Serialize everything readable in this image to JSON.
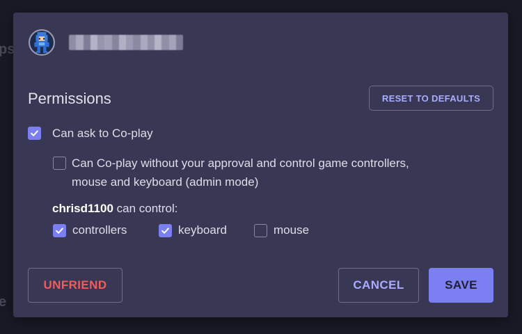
{
  "colors": {
    "dialog_bg": "#383854",
    "accent": "#7b7ff2",
    "accent_text": "#a9acff",
    "danger": "#f25c5c"
  },
  "dialog": {
    "title": "Permissions",
    "reset_label": "RESET TO DEFAULTS",
    "options": {
      "co_play": {
        "label": "Can ask to Co-play",
        "checked": true
      },
      "admin_mode": {
        "line1": "Can Co-play without your approval and control game controllers,",
        "line2": "mouse and keyboard (admin mode)",
        "checked": false
      }
    },
    "control": {
      "username": "chrisd1100",
      "suffix": " can control:",
      "items": [
        {
          "label": "controllers",
          "checked": true
        },
        {
          "label": "keyboard",
          "checked": true
        },
        {
          "label": "mouse",
          "checked": false
        }
      ]
    },
    "buttons": {
      "unfriend": "UNFRIEND",
      "cancel": "CANCEL",
      "save": "SAVE"
    }
  },
  "icons": {
    "avatar": "pixel-avatar-icon",
    "checkbox_check": "checkmark-icon"
  }
}
